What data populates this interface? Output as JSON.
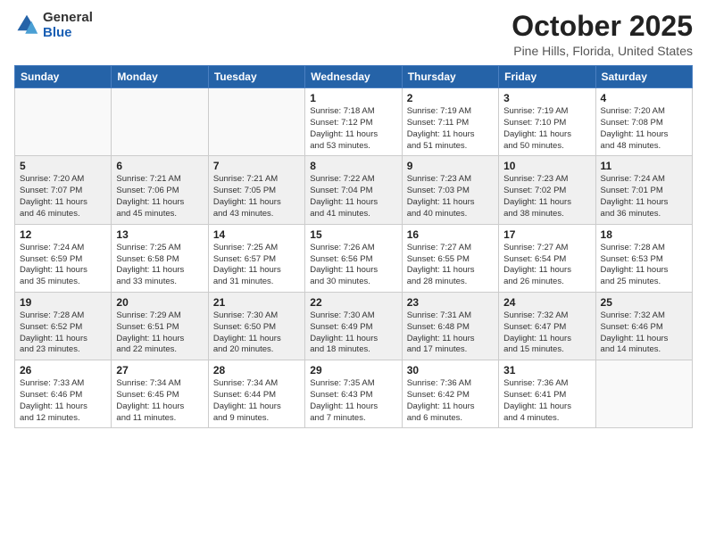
{
  "header": {
    "logo_general": "General",
    "logo_blue": "Blue",
    "month_title": "October 2025",
    "location": "Pine Hills, Florida, United States"
  },
  "weekdays": [
    "Sunday",
    "Monday",
    "Tuesday",
    "Wednesday",
    "Thursday",
    "Friday",
    "Saturday"
  ],
  "weeks": [
    [
      {
        "day": "",
        "info": ""
      },
      {
        "day": "",
        "info": ""
      },
      {
        "day": "",
        "info": ""
      },
      {
        "day": "1",
        "info": "Sunrise: 7:18 AM\nSunset: 7:12 PM\nDaylight: 11 hours\nand 53 minutes."
      },
      {
        "day": "2",
        "info": "Sunrise: 7:19 AM\nSunset: 7:11 PM\nDaylight: 11 hours\nand 51 minutes."
      },
      {
        "day": "3",
        "info": "Sunrise: 7:19 AM\nSunset: 7:10 PM\nDaylight: 11 hours\nand 50 minutes."
      },
      {
        "day": "4",
        "info": "Sunrise: 7:20 AM\nSunset: 7:08 PM\nDaylight: 11 hours\nand 48 minutes."
      }
    ],
    [
      {
        "day": "5",
        "info": "Sunrise: 7:20 AM\nSunset: 7:07 PM\nDaylight: 11 hours\nand 46 minutes."
      },
      {
        "day": "6",
        "info": "Sunrise: 7:21 AM\nSunset: 7:06 PM\nDaylight: 11 hours\nand 45 minutes."
      },
      {
        "day": "7",
        "info": "Sunrise: 7:21 AM\nSunset: 7:05 PM\nDaylight: 11 hours\nand 43 minutes."
      },
      {
        "day": "8",
        "info": "Sunrise: 7:22 AM\nSunset: 7:04 PM\nDaylight: 11 hours\nand 41 minutes."
      },
      {
        "day": "9",
        "info": "Sunrise: 7:23 AM\nSunset: 7:03 PM\nDaylight: 11 hours\nand 40 minutes."
      },
      {
        "day": "10",
        "info": "Sunrise: 7:23 AM\nSunset: 7:02 PM\nDaylight: 11 hours\nand 38 minutes."
      },
      {
        "day": "11",
        "info": "Sunrise: 7:24 AM\nSunset: 7:01 PM\nDaylight: 11 hours\nand 36 minutes."
      }
    ],
    [
      {
        "day": "12",
        "info": "Sunrise: 7:24 AM\nSunset: 6:59 PM\nDaylight: 11 hours\nand 35 minutes."
      },
      {
        "day": "13",
        "info": "Sunrise: 7:25 AM\nSunset: 6:58 PM\nDaylight: 11 hours\nand 33 minutes."
      },
      {
        "day": "14",
        "info": "Sunrise: 7:25 AM\nSunset: 6:57 PM\nDaylight: 11 hours\nand 31 minutes."
      },
      {
        "day": "15",
        "info": "Sunrise: 7:26 AM\nSunset: 6:56 PM\nDaylight: 11 hours\nand 30 minutes."
      },
      {
        "day": "16",
        "info": "Sunrise: 7:27 AM\nSunset: 6:55 PM\nDaylight: 11 hours\nand 28 minutes."
      },
      {
        "day": "17",
        "info": "Sunrise: 7:27 AM\nSunset: 6:54 PM\nDaylight: 11 hours\nand 26 minutes."
      },
      {
        "day": "18",
        "info": "Sunrise: 7:28 AM\nSunset: 6:53 PM\nDaylight: 11 hours\nand 25 minutes."
      }
    ],
    [
      {
        "day": "19",
        "info": "Sunrise: 7:28 AM\nSunset: 6:52 PM\nDaylight: 11 hours\nand 23 minutes."
      },
      {
        "day": "20",
        "info": "Sunrise: 7:29 AM\nSunset: 6:51 PM\nDaylight: 11 hours\nand 22 minutes."
      },
      {
        "day": "21",
        "info": "Sunrise: 7:30 AM\nSunset: 6:50 PM\nDaylight: 11 hours\nand 20 minutes."
      },
      {
        "day": "22",
        "info": "Sunrise: 7:30 AM\nSunset: 6:49 PM\nDaylight: 11 hours\nand 18 minutes."
      },
      {
        "day": "23",
        "info": "Sunrise: 7:31 AM\nSunset: 6:48 PM\nDaylight: 11 hours\nand 17 minutes."
      },
      {
        "day": "24",
        "info": "Sunrise: 7:32 AM\nSunset: 6:47 PM\nDaylight: 11 hours\nand 15 minutes."
      },
      {
        "day": "25",
        "info": "Sunrise: 7:32 AM\nSunset: 6:46 PM\nDaylight: 11 hours\nand 14 minutes."
      }
    ],
    [
      {
        "day": "26",
        "info": "Sunrise: 7:33 AM\nSunset: 6:46 PM\nDaylight: 11 hours\nand 12 minutes."
      },
      {
        "day": "27",
        "info": "Sunrise: 7:34 AM\nSunset: 6:45 PM\nDaylight: 11 hours\nand 11 minutes."
      },
      {
        "day": "28",
        "info": "Sunrise: 7:34 AM\nSunset: 6:44 PM\nDaylight: 11 hours\nand 9 minutes."
      },
      {
        "day": "29",
        "info": "Sunrise: 7:35 AM\nSunset: 6:43 PM\nDaylight: 11 hours\nand 7 minutes."
      },
      {
        "day": "30",
        "info": "Sunrise: 7:36 AM\nSunset: 6:42 PM\nDaylight: 11 hours\nand 6 minutes."
      },
      {
        "day": "31",
        "info": "Sunrise: 7:36 AM\nSunset: 6:41 PM\nDaylight: 11 hours\nand 4 minutes."
      },
      {
        "day": "",
        "info": ""
      }
    ]
  ]
}
